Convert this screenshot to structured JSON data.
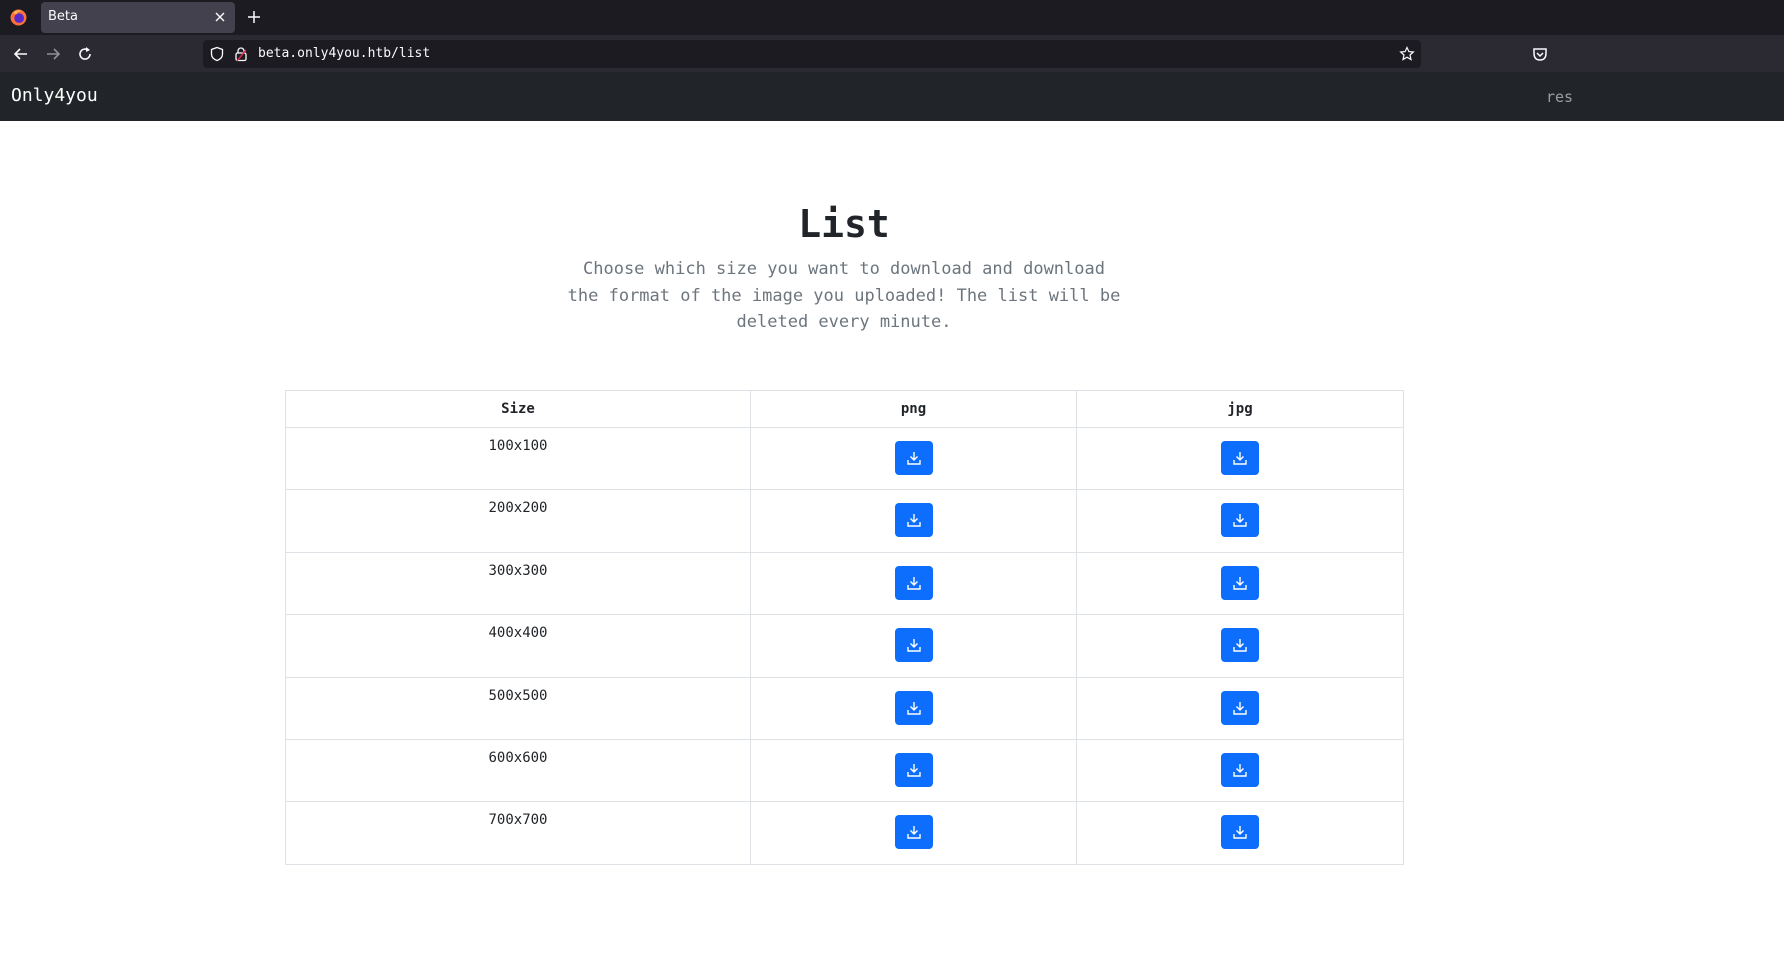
{
  "browser": {
    "tab_title": "Beta",
    "url": "beta.only4you.htb/list"
  },
  "site": {
    "brand": "Only4you",
    "nav_right": "res"
  },
  "page": {
    "title": "List",
    "description": "Choose which size you want to download and download the format of the image you uploaded! The list will be deleted every minute."
  },
  "table": {
    "headers": [
      "Size",
      "png",
      "jpg"
    ],
    "rows": [
      {
        "size": "100x100"
      },
      {
        "size": "200x200"
      },
      {
        "size": "300x300"
      },
      {
        "size": "400x400"
      },
      {
        "size": "500x500"
      },
      {
        "size": "600x600"
      },
      {
        "size": "700x700"
      }
    ]
  },
  "colors": {
    "primary": "#0d6efd",
    "navbar": "#212529",
    "chrome": "#1c1b22"
  },
  "icons": [
    "firefox-logo-icon",
    "close-icon",
    "plus-icon",
    "back-arrow-icon",
    "forward-arrow-icon",
    "reload-icon",
    "shield-icon",
    "lock-icon",
    "star-icon",
    "pocket-icon",
    "download-icon"
  ]
}
